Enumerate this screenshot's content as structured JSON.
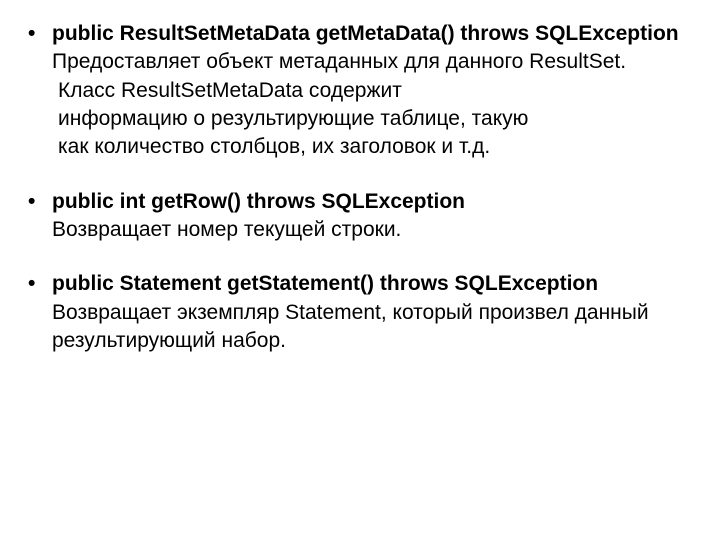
{
  "items": [
    {
      "signature": "public ResultSetMetaData getMetaData() throws SQLException",
      "desc": "Предоставляет объект метаданных для данного ResultSet.",
      "extra1": "Класс ResultSetMetaData содержит",
      "extra2": "информацию о результирующие таблице, такую",
      "extra3": "как количество столбцов, их заголовок и т.д."
    },
    {
      "signature": "public int getRow() throws SQLException",
      "desc": "Возвращает номер текущей строки."
    },
    {
      "signature": "public Statement getStatement() throws SQLException",
      "desc": "Возвращает экземпляр Statement, который произвел данный результирующий набор."
    }
  ]
}
